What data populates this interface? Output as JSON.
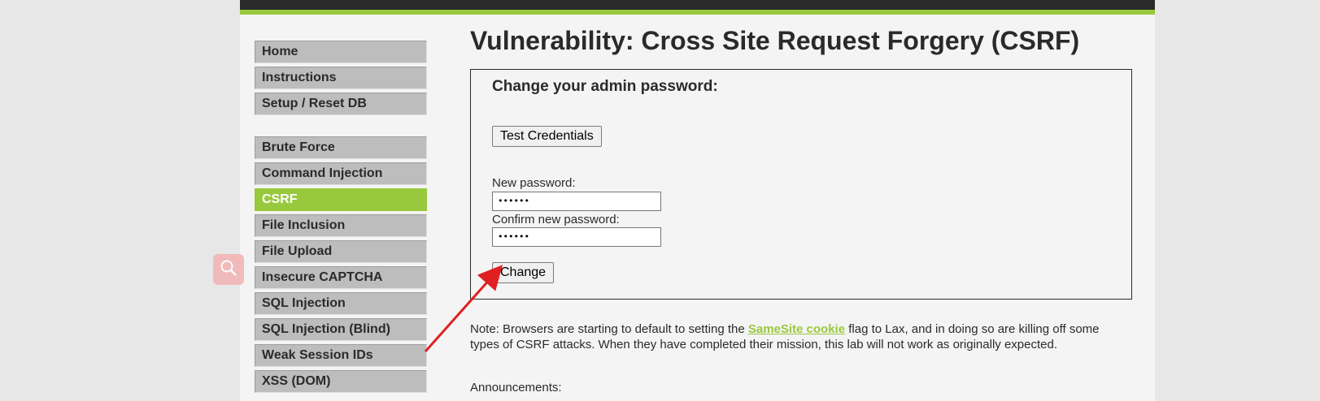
{
  "menu": {
    "group1": [
      "Home",
      "Instructions",
      "Setup / Reset DB"
    ],
    "group2": [
      "Brute Force",
      "Command Injection",
      "CSRF",
      "File Inclusion",
      "File Upload",
      "Insecure CAPTCHA",
      "SQL Injection",
      "SQL Injection (Blind)",
      "Weak Session IDs",
      "XSS (DOM)"
    ],
    "selected": "CSRF"
  },
  "page_title": "Vulnerability: Cross Site Request Forgery (CSRF)",
  "form": {
    "heading": "Change your admin password:",
    "test_button": "Test Credentials",
    "new_password_label": "New password:",
    "new_password_value": "••••••",
    "confirm_password_label": "Confirm new password:",
    "confirm_password_value": "••••••",
    "change_button": "Change"
  },
  "note": {
    "before": "Note: Browsers are starting to default to setting the ",
    "link": "SameSite cookie",
    "after": " flag to Lax, and in doing so are killing off some types of CSRF attacks. When they have completed their mission, this lab will not work as originally expected."
  },
  "announcements": "Announcements:",
  "colors": {
    "accent": "#98c93c",
    "topbar": "#2a2a2a",
    "arrow": "#e02020"
  },
  "overlay_icon": "search-icon"
}
